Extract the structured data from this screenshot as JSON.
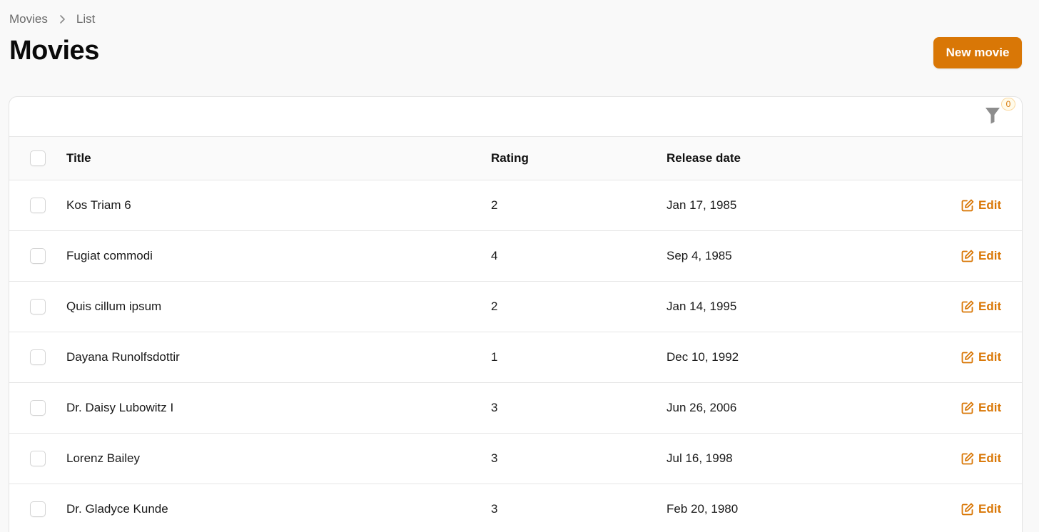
{
  "breadcrumb": {
    "items": [
      "Movies",
      "List"
    ]
  },
  "page": {
    "title": "Movies",
    "new_button_label": "New movie"
  },
  "filter": {
    "count": "0"
  },
  "table": {
    "columns": {
      "title": "Title",
      "rating": "Rating",
      "release_date": "Release date"
    },
    "rows": [
      {
        "title": "Kos Triam 6",
        "rating": "2",
        "release_date": "Jan 17, 1985",
        "action": "Edit"
      },
      {
        "title": "Fugiat commodi",
        "rating": "4",
        "release_date": "Sep 4, 1985",
        "action": "Edit"
      },
      {
        "title": "Quis cillum ipsum",
        "rating": "2",
        "release_date": "Jan 14, 1995",
        "action": "Edit"
      },
      {
        "title": "Dayana Runolfsdottir",
        "rating": "1",
        "release_date": "Dec 10, 1992",
        "action": "Edit"
      },
      {
        "title": "Dr. Daisy Lubowitz I",
        "rating": "3",
        "release_date": "Jun 26, 2006",
        "action": "Edit"
      },
      {
        "title": "Lorenz Bailey",
        "rating": "3",
        "release_date": "Jul 16, 1998",
        "action": "Edit"
      },
      {
        "title": "Dr. Gladyce Kunde",
        "rating": "3",
        "release_date": "Feb 20, 1980",
        "action": "Edit"
      }
    ]
  },
  "icons": {
    "breadcrumb_separator": "chevron-right-icon",
    "filter": "funnel-icon",
    "edit": "edit-icon"
  },
  "colors": {
    "accent": "#d97706",
    "background": "#f9f9f9"
  }
}
